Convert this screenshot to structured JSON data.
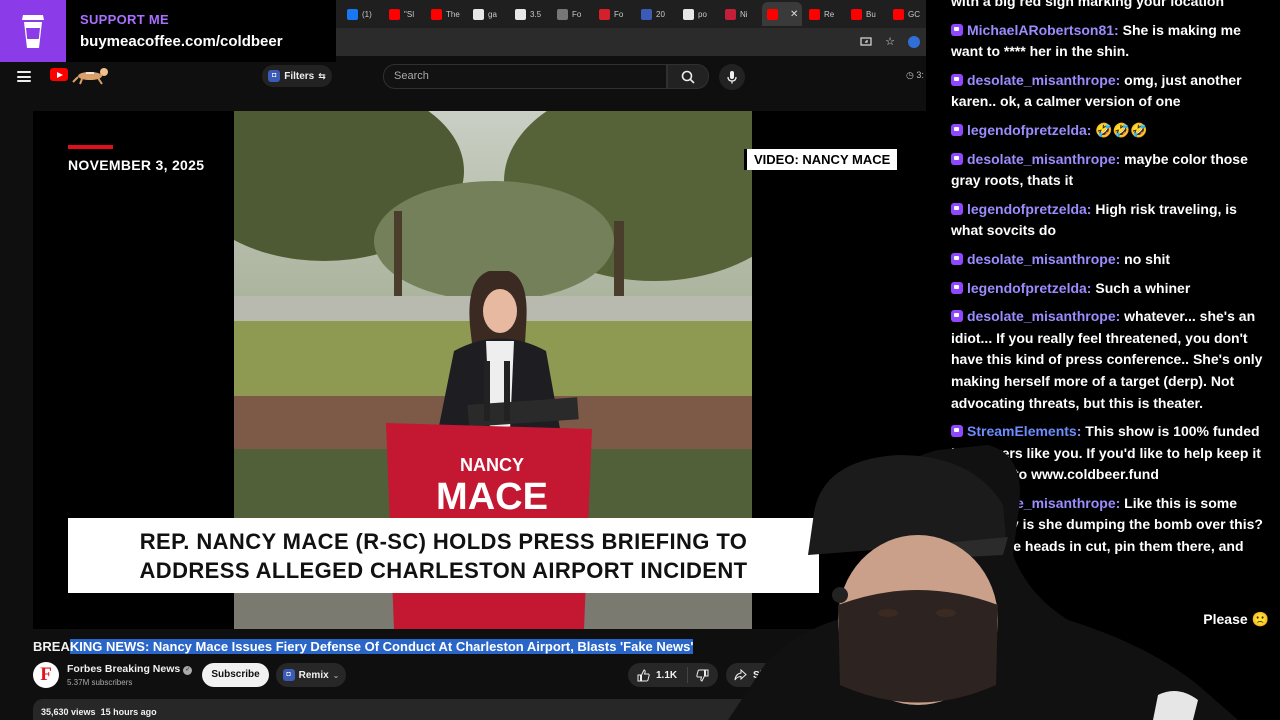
{
  "support_banner": {
    "title": "SUPPORT ME",
    "url": "buymeacoffee.com/coldbeer"
  },
  "browser": {
    "tabs": [
      {
        "label": "(1)",
        "favicon_color": "#1877f2",
        "active": false
      },
      {
        "label": "\"SI",
        "favicon_color": "#ff0000",
        "active": false
      },
      {
        "label": "The",
        "favicon_color": "#ff0000",
        "active": false
      },
      {
        "label": "ga",
        "favicon_color": "#e8e8e8",
        "active": false
      },
      {
        "label": "3.5",
        "favicon_color": "#e8e8e8",
        "active": false
      },
      {
        "label": "Fo",
        "favicon_color": "#777777",
        "active": false
      },
      {
        "label": "Fo",
        "favicon_color": "#d4202a",
        "active": false
      },
      {
        "label": "20",
        "favicon_color": "#3b5bb7",
        "active": false
      },
      {
        "label": "po",
        "favicon_color": "#e8e8e8",
        "active": false
      },
      {
        "label": "Ni",
        "favicon_color": "#c41e3a",
        "active": false
      },
      {
        "label": "",
        "favicon_color": "#ff0000",
        "active": true
      },
      {
        "label": "Re",
        "favicon_color": "#ff0000",
        "active": false
      },
      {
        "label": "Bu",
        "favicon_color": "#ff0000",
        "active": false
      },
      {
        "label": "GC",
        "favicon_color": "#ff0000",
        "active": false
      }
    ],
    "close_glyph": "✕"
  },
  "youtube": {
    "filters_label": "Filters",
    "search_placeholder": "Search",
    "timer_chip": "3:"
  },
  "player": {
    "date": "NOVEMBER 3, 2025",
    "credit": "VIDEO: NANCY MACE",
    "podium_line1": "NANCY",
    "podium_line2": "MACE",
    "lower_third_line1": "REP. NANCY MACE (R-SC) HOLDS PRESS BRIEFING TO",
    "lower_third_line2": "ADDRESS ALLEGED CHARLESTON AIRPORT INCIDENT"
  },
  "video": {
    "title_prefix": "BREA",
    "title_highlight": "KING NEWS: Nancy Mace Issues Fiery Defense Of Conduct At Charleston Airport, Blasts 'Fake News'",
    "channel_initial": "F",
    "channel_name": "Forbes Breaking News",
    "subscribers": "5.37M subscribers",
    "subscribe_label": "Subscribe",
    "remix_label": "Remix",
    "likes": "1.1K",
    "share_label": "Sh",
    "views": "35,630 views",
    "age": "15 hours ago"
  },
  "chat": {
    "messages": [
      {
        "user": "",
        "text": "with a big red sign marking your location"
      },
      {
        "user": "MichaelARobertson81",
        "text": "She is making me want to **** her in the shin."
      },
      {
        "user": "desolate_misanthrope",
        "text": "omg, just another karen.. ok, a calmer version of one"
      },
      {
        "user": "legendofpretzelda",
        "text": "🤣🤣🤣"
      },
      {
        "user": "desolate_misanthrope",
        "text": "maybe color those gray roots, thats it"
      },
      {
        "user": "legendofpretzelda",
        "text": "High risk traveling, is what sovcits do"
      },
      {
        "user": "desolate_misanthrope",
        "text": "no shit"
      },
      {
        "user": "legendofpretzelda",
        "text": "Such a whiner"
      },
      {
        "user": "desolate_misanthrope",
        "text": "whatever... she's an idiot... If you really feel threatened, you don't have this kind of press conference.. She's only making herself more of a target (derp). Not advocating threats, but this is theater."
      },
      {
        "user": "StreamElements",
        "text": "This show is 100% funded by viewers like you. If you'd like to help keep it going go to www.coldbeer.fund"
      },
      {
        "user": "desolate_misanthrope",
        "text": "Like this is some shit... why is she dumping the bomb over this? Ya pull the heads in cut, pin them there, and move on..."
      },
      {
        "user": "",
        "text": "Please 🙁"
      }
    ]
  },
  "colors": {
    "twitch_purple": "#9147ff",
    "youtube_red": "#ff0000",
    "highlight_blue": "#2a66c8"
  }
}
